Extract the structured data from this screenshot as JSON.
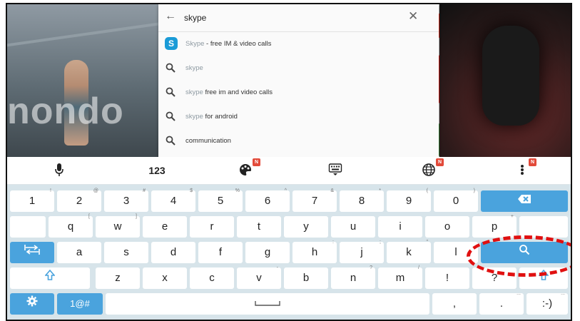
{
  "background": {
    "watermark": "nondo"
  },
  "search": {
    "query": "skype",
    "back_icon": "arrow-left-icon",
    "clear_icon": "close-icon",
    "suggestions": [
      {
        "icon": "skype-app-icon",
        "logo_letter": "S",
        "prefix": "Skype",
        "suffix": " - free IM & video calls"
      },
      {
        "icon": "search-icon",
        "prefix": "skype",
        "suffix": ""
      },
      {
        "icon": "search-icon",
        "prefix": "skype",
        "suffix": " free im and video calls"
      },
      {
        "icon": "search-icon",
        "prefix": "skype",
        "suffix": " for android"
      },
      {
        "icon": "search-icon",
        "prefix": "",
        "suffix": "communication"
      }
    ]
  },
  "keyboard": {
    "toolbar": {
      "numbers_label": "123",
      "badge": "N",
      "icons": [
        "microphone-icon",
        "theme-palette-icon",
        "keyboard-hide-icon",
        "globe-icon",
        "more-vertical-icon"
      ]
    },
    "number_row": [
      {
        "k": "1",
        "s": "!"
      },
      {
        "k": "2",
        "s": "@"
      },
      {
        "k": "3",
        "s": "#"
      },
      {
        "k": "4",
        "s": "$"
      },
      {
        "k": "5",
        "s": "%"
      },
      {
        "k": "6",
        "s": "^"
      },
      {
        "k": "7",
        "s": "&"
      },
      {
        "k": "8",
        "s": "*"
      },
      {
        "k": "9",
        "s": "("
      },
      {
        "k": "0",
        "s": ")"
      }
    ],
    "row_q": [
      {
        "k": "q",
        "s": "["
      },
      {
        "k": "w",
        "s": "]"
      },
      {
        "k": "e",
        "s": ""
      },
      {
        "k": "r",
        "s": ""
      },
      {
        "k": "t",
        "s": ""
      },
      {
        "k": "y",
        "s": ""
      },
      {
        "k": "u",
        "s": ""
      },
      {
        "k": "i",
        "s": ""
      },
      {
        "k": "o",
        "s": ""
      },
      {
        "k": "p",
        "s": "+"
      }
    ],
    "row_a": [
      {
        "k": "a",
        "s": ""
      },
      {
        "k": "s",
        "s": ""
      },
      {
        "k": "d",
        "s": ""
      },
      {
        "k": "f",
        "s": ""
      },
      {
        "k": "g",
        "s": ""
      },
      {
        "k": "h",
        "s": ":"
      },
      {
        "k": "j",
        "s": ";"
      },
      {
        "k": "k",
        "s": "\""
      },
      {
        "k": "l",
        "s": ""
      }
    ],
    "row_z": [
      {
        "k": "z",
        "s": ""
      },
      {
        "k": "x",
        "s": ""
      },
      {
        "k": "c",
        "s": ""
      },
      {
        "k": "v",
        "s": "-"
      },
      {
        "k": "b",
        "s": ""
      },
      {
        "k": "n",
        "s": "?"
      },
      {
        "k": "m",
        "s": "/"
      },
      {
        "k": "!",
        "s": ""
      },
      {
        "k": "?",
        "s": ""
      }
    ],
    "symbols_label": "1@#",
    "comma": ",",
    "period": ".",
    "emoticon": ":-)",
    "more_marker": "...",
    "accent_color": "#4aa3dd"
  }
}
